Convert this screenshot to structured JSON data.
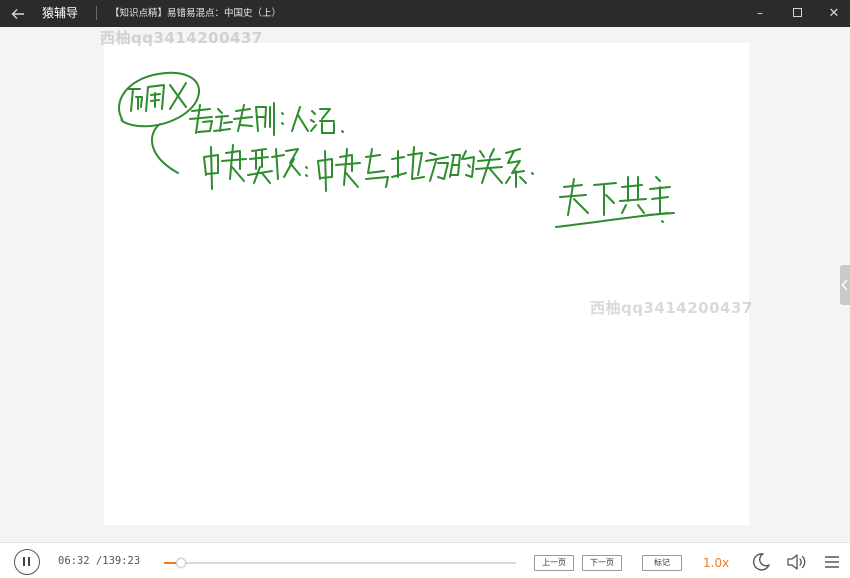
{
  "titlebar": {
    "back_icon": "arrow-left-icon",
    "app_name": "猿辅导",
    "course_title": "【知识点精】易错易混点：中国史（上）",
    "minimize_label": "–",
    "close_label": "✕"
  },
  "slide": {
    "watermark": "西柚qq3414200437",
    "handwriting_color": "#2e8b2e",
    "handwriting": {
      "circled_heading": "而周X",
      "line1_term": "君主专制",
      "line1_note": "人治",
      "line2_term": "中央集权",
      "line2_note": "中央与地方的关系",
      "side_note": "天下共主"
    }
  },
  "player": {
    "state": "paused",
    "time_text": "06:32 /139:23",
    "progress_fraction": 0.047,
    "prev_page_label": "上一页",
    "next_page_label": "下一页",
    "mark_label": "标记",
    "speed_label": "1.0x",
    "accent_color": "#f07c22",
    "night_icon": "moon-icon",
    "volume_icon": "volume-icon",
    "menu_icon": "menu-icon"
  }
}
